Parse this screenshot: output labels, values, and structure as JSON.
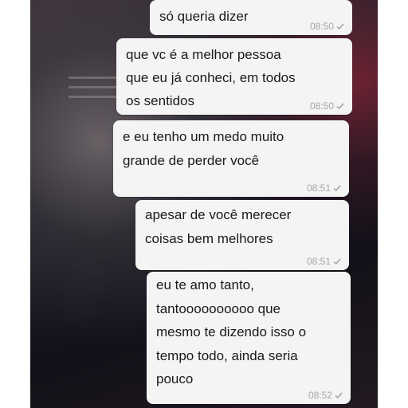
{
  "conversation": {
    "messages": [
      {
        "text": "só queria dizer",
        "time": "08:50"
      },
      {
        "text": "que vc é a melhor pessoa\nque eu já conheci, em todos\nos sentidos",
        "time": "08:50"
      },
      {
        "text": "e eu tenho um medo muito\ngrande de perder você",
        "time": "08:51"
      },
      {
        "text": "apesar de você merecer\ncoisas bem melhores",
        "time": "08:51"
      },
      {
        "text": "eu te amo tanto,\ntantoooooooooo que\nmesmo te dizendo isso o\ntempo todo, ainda seria\npouco",
        "time": "08:52"
      }
    ]
  },
  "status_icon": "single-check-icon",
  "colors": {
    "bubble": "#f4f4f4",
    "timestamp": "#a6a6a6",
    "check": "#9e9e9e"
  }
}
